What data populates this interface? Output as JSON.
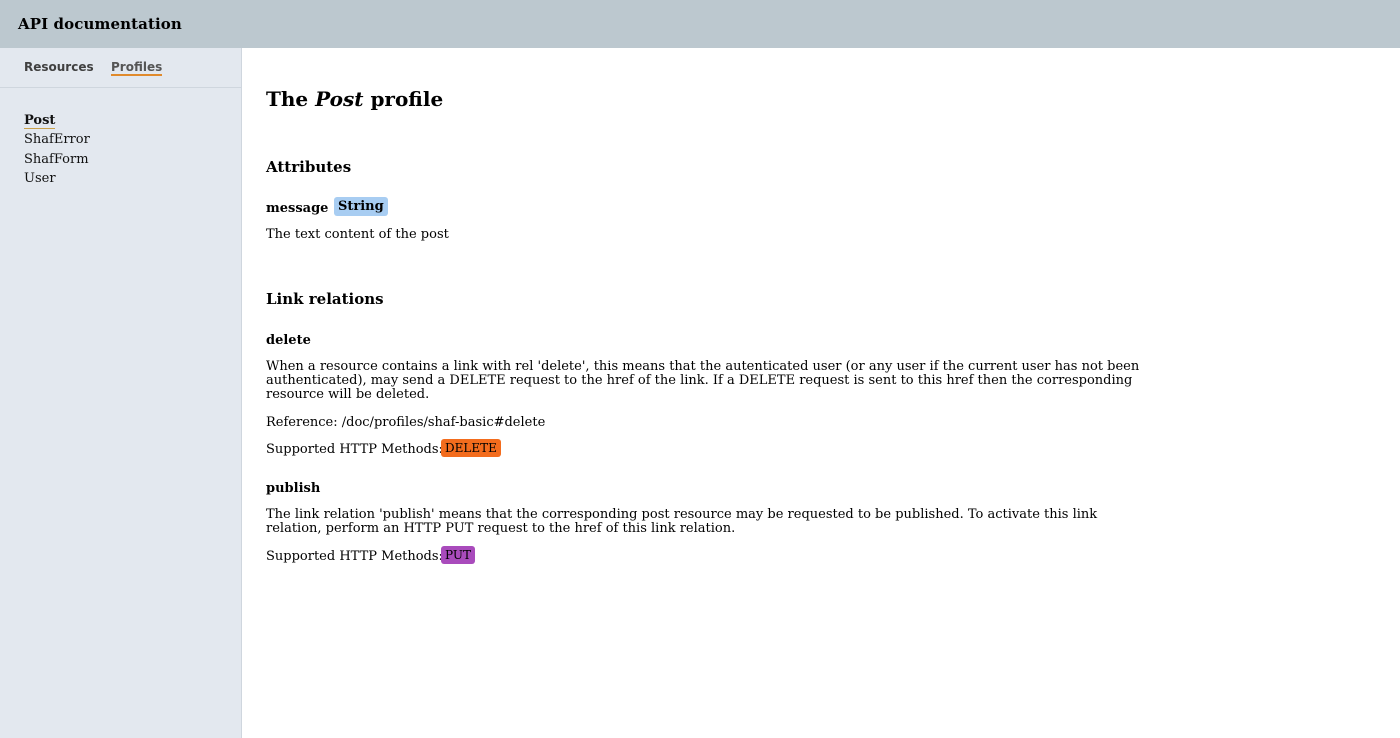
{
  "app": {
    "title": "API documentation"
  },
  "sidebar": {
    "tabs": [
      {
        "label": "Resources"
      },
      {
        "label": "Profiles"
      }
    ],
    "profiles": [
      "Post",
      "ShafError",
      "ShafForm",
      "User"
    ],
    "active_profile": "Post"
  },
  "main": {
    "title_prefix": "The",
    "title_name": "Post",
    "title_suffix": "profile",
    "attributes_heading": "Attributes",
    "attributes": [
      {
        "name": "message",
        "type": "String",
        "description": "The text content of the post"
      }
    ],
    "links_heading": "Link relations",
    "links": [
      {
        "name": "delete",
        "description": "When a resource contains a link with rel 'delete', this means that the autenticated user (or any user if the current user has not been authenticated), may send a DELETE request to the href of the link. If a DELETE request is sent to this href then the corresponding resource will be deleted.",
        "reference": "Reference: /doc/profiles/shaf-basic#delete",
        "methods_label": "Supported HTTP Methods:",
        "methods": [
          "DELETE"
        ]
      },
      {
        "name": "publish",
        "description": "The link relation 'publish' means that the corresponding post resource may be requested to be published. To activate this link relation, perform an HTTP PUT request to the href of this link relation.",
        "methods_label": "Supported HTTP Methods:",
        "methods": [
          "PUT"
        ]
      }
    ]
  },
  "colors": {
    "topbar": "#bcc8cf",
    "sidebar": "#e3e8ef",
    "string_badge": "#a8cdf2",
    "delete_badge": "#f36c1d",
    "put_badge": "#a94bbc",
    "tab_underline": "#e08a2c"
  }
}
